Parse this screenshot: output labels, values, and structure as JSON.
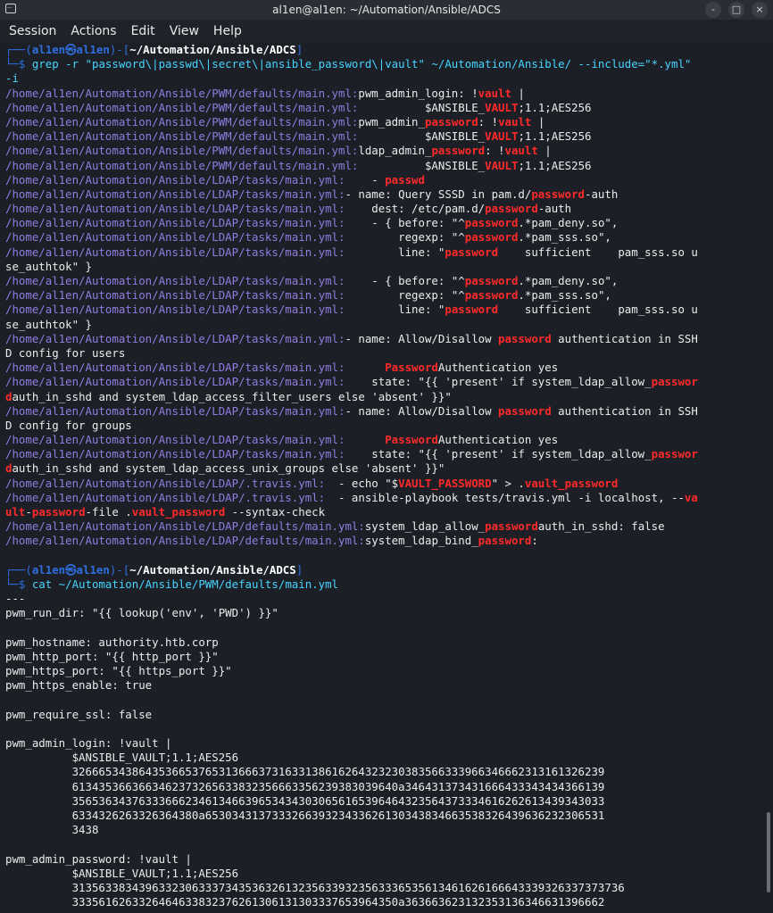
{
  "window": {
    "title": "al1en@al1en: ~/Automation/Ansible/ADCS"
  },
  "menu": [
    "Session",
    "Actions",
    "Edit",
    "View",
    "Help"
  ],
  "controls": {
    "minimize": "-",
    "maximize": "□",
    "close": "×"
  },
  "lines": [
    [
      {
        "c": "p",
        "t": "┌──("
      },
      {
        "c": "u",
        "t": "al1en㉿al1en"
      },
      {
        "c": "p",
        "t": ")-["
      },
      {
        "c": "d",
        "t": "~/Automation/Ansible/ADCS"
      },
      {
        "c": "p",
        "t": "]"
      }
    ],
    [
      {
        "c": "p",
        "t": "└─$ "
      },
      {
        "c": "cmd",
        "t": "grep -r \"password\\|passwd\\|secret\\|ansible_password\\|vault\" ~/Automation/Ansible/ --include=\"*.yml\""
      }
    ],
    [
      {
        "c": "cmd",
        "t": "-i"
      }
    ],
    [
      {
        "c": "path",
        "t": "/home/al1en/Automation/Ansible/PWM/defaults/main.yml:"
      },
      {
        "c": "o",
        "t": "pwm_admin_login: !"
      },
      {
        "c": "h",
        "t": "vault"
      },
      {
        "c": "o",
        "t": " |"
      }
    ],
    [
      {
        "c": "path",
        "t": "/home/al1en/Automation/Ansible/PWM/defaults/main.yml:"
      },
      {
        "c": "o",
        "t": "          $ANSIBLE_"
      },
      {
        "c": "h",
        "t": "VAULT"
      },
      {
        "c": "o",
        "t": ";1.1;AES256"
      }
    ],
    [
      {
        "c": "path",
        "t": "/home/al1en/Automation/Ansible/PWM/defaults/main.yml:"
      },
      {
        "c": "o",
        "t": "pwm_admin_"
      },
      {
        "c": "h",
        "t": "password"
      },
      {
        "c": "o",
        "t": ": !"
      },
      {
        "c": "h",
        "t": "vault"
      },
      {
        "c": "o",
        "t": " |"
      }
    ],
    [
      {
        "c": "path",
        "t": "/home/al1en/Automation/Ansible/PWM/defaults/main.yml:"
      },
      {
        "c": "o",
        "t": "          $ANSIBLE_"
      },
      {
        "c": "h",
        "t": "VAULT"
      },
      {
        "c": "o",
        "t": ";1.1;AES256"
      }
    ],
    [
      {
        "c": "path",
        "t": "/home/al1en/Automation/Ansible/PWM/defaults/main.yml:"
      },
      {
        "c": "o",
        "t": "ldap_admin_"
      },
      {
        "c": "h",
        "t": "password"
      },
      {
        "c": "o",
        "t": ": !"
      },
      {
        "c": "h",
        "t": "vault"
      },
      {
        "c": "o",
        "t": " |"
      }
    ],
    [
      {
        "c": "path",
        "t": "/home/al1en/Automation/Ansible/PWM/defaults/main.yml:"
      },
      {
        "c": "o",
        "t": "          $ANSIBLE_"
      },
      {
        "c": "h",
        "t": "VAULT"
      },
      {
        "c": "o",
        "t": ";1.1;AES256"
      }
    ],
    [
      {
        "c": "path",
        "t": "/home/al1en/Automation/Ansible/LDAP/tasks/main.yml:"
      },
      {
        "c": "o",
        "t": "    - "
      },
      {
        "c": "h",
        "t": "passwd"
      }
    ],
    [
      {
        "c": "path",
        "t": "/home/al1en/Automation/Ansible/LDAP/tasks/main.yml:"
      },
      {
        "c": "o",
        "t": "- name: Query SSSD in pam.d/"
      },
      {
        "c": "h",
        "t": "password"
      },
      {
        "c": "o",
        "t": "-auth"
      }
    ],
    [
      {
        "c": "path",
        "t": "/home/al1en/Automation/Ansible/LDAP/tasks/main.yml:"
      },
      {
        "c": "o",
        "t": "    dest: /etc/pam.d/"
      },
      {
        "c": "h",
        "t": "password"
      },
      {
        "c": "o",
        "t": "-auth"
      }
    ],
    [
      {
        "c": "path",
        "t": "/home/al1en/Automation/Ansible/LDAP/tasks/main.yml:"
      },
      {
        "c": "o",
        "t": "    - { before: \"^"
      },
      {
        "c": "h",
        "t": "password"
      },
      {
        "c": "o",
        "t": ".*pam_deny.so\","
      }
    ],
    [
      {
        "c": "path",
        "t": "/home/al1en/Automation/Ansible/LDAP/tasks/main.yml:"
      },
      {
        "c": "o",
        "t": "        regexp: \"^"
      },
      {
        "c": "h",
        "t": "password"
      },
      {
        "c": "o",
        "t": ".*pam_sss.so\","
      }
    ],
    [
      {
        "c": "path",
        "t": "/home/al1en/Automation/Ansible/LDAP/tasks/main.yml:"
      },
      {
        "c": "o",
        "t": "        line: \""
      },
      {
        "c": "h",
        "t": "password"
      },
      {
        "c": "o",
        "t": "    sufficient    pam_sss.so u"
      }
    ],
    [
      {
        "c": "o",
        "t": "se_authtok\" }"
      }
    ],
    [
      {
        "c": "path",
        "t": "/home/al1en/Automation/Ansible/LDAP/tasks/main.yml:"
      },
      {
        "c": "o",
        "t": "    - { before: \"^"
      },
      {
        "c": "h",
        "t": "password"
      },
      {
        "c": "o",
        "t": ".*pam_deny.so\","
      }
    ],
    [
      {
        "c": "path",
        "t": "/home/al1en/Automation/Ansible/LDAP/tasks/main.yml:"
      },
      {
        "c": "o",
        "t": "        regexp: \"^"
      },
      {
        "c": "h",
        "t": "password"
      },
      {
        "c": "o",
        "t": ".*pam_sss.so\","
      }
    ],
    [
      {
        "c": "path",
        "t": "/home/al1en/Automation/Ansible/LDAP/tasks/main.yml:"
      },
      {
        "c": "o",
        "t": "        line: \""
      },
      {
        "c": "h",
        "t": "password"
      },
      {
        "c": "o",
        "t": "    sufficient    pam_sss.so u"
      }
    ],
    [
      {
        "c": "o",
        "t": "se_authtok\" }"
      }
    ],
    [
      {
        "c": "path",
        "t": "/home/al1en/Automation/Ansible/LDAP/tasks/main.yml:"
      },
      {
        "c": "o",
        "t": "- name: Allow/Disallow "
      },
      {
        "c": "h",
        "t": "password"
      },
      {
        "c": "o",
        "t": " authentication in SSH"
      }
    ],
    [
      {
        "c": "o",
        "t": "D config for users"
      }
    ],
    [
      {
        "c": "path",
        "t": "/home/al1en/Automation/Ansible/LDAP/tasks/main.yml:"
      },
      {
        "c": "o",
        "t": "      "
      },
      {
        "c": "h",
        "t": "Password"
      },
      {
        "c": "o",
        "t": "Authentication yes"
      }
    ],
    [
      {
        "c": "path",
        "t": "/home/al1en/Automation/Ansible/LDAP/tasks/main.yml:"
      },
      {
        "c": "o",
        "t": "    state: \"{{ 'present' if system_ldap_allow_"
      },
      {
        "c": "h",
        "t": "passwor"
      }
    ],
    [
      {
        "c": "h",
        "t": "d"
      },
      {
        "c": "o",
        "t": "auth_in_sshd and system_ldap_access_filter_users else 'absent' }}\""
      }
    ],
    [
      {
        "c": "path",
        "t": "/home/al1en/Automation/Ansible/LDAP/tasks/main.yml:"
      },
      {
        "c": "o",
        "t": "- name: Allow/Disallow "
      },
      {
        "c": "h",
        "t": "password"
      },
      {
        "c": "o",
        "t": " authentication in SSH"
      }
    ],
    [
      {
        "c": "o",
        "t": "D config for groups"
      }
    ],
    [
      {
        "c": "path",
        "t": "/home/al1en/Automation/Ansible/LDAP/tasks/main.yml:"
      },
      {
        "c": "o",
        "t": "      "
      },
      {
        "c": "h",
        "t": "Password"
      },
      {
        "c": "o",
        "t": "Authentication yes"
      }
    ],
    [
      {
        "c": "path",
        "t": "/home/al1en/Automation/Ansible/LDAP/tasks/main.yml:"
      },
      {
        "c": "o",
        "t": "    state: \"{{ 'present' if system_ldap_allow_"
      },
      {
        "c": "h",
        "t": "passwor"
      }
    ],
    [
      {
        "c": "h",
        "t": "d"
      },
      {
        "c": "o",
        "t": "auth_in_sshd and system_ldap_access_unix_groups else 'absent' }}\""
      }
    ],
    [
      {
        "c": "path",
        "t": "/home/al1en/Automation/Ansible/LDAP/.travis.yml:"
      },
      {
        "c": "o",
        "t": "  - echo \"$"
      },
      {
        "c": "h",
        "t": "VAULT_PASSWORD"
      },
      {
        "c": "o",
        "t": "\" > ."
      },
      {
        "c": "h",
        "t": "vault_password"
      }
    ],
    [
      {
        "c": "path",
        "t": "/home/al1en/Automation/Ansible/LDAP/.travis.yml:"
      },
      {
        "c": "o",
        "t": "  - ansible-playbook tests/travis.yml -i localhost, --"
      },
      {
        "c": "h",
        "t": "va"
      }
    ],
    [
      {
        "c": "h",
        "t": "ult"
      },
      {
        "c": "o",
        "t": "-"
      },
      {
        "c": "h",
        "t": "password"
      },
      {
        "c": "o",
        "t": "-file ."
      },
      {
        "c": "h",
        "t": "vault_password"
      },
      {
        "c": "o",
        "t": " --syntax-check"
      }
    ],
    [
      {
        "c": "path",
        "t": "/home/al1en/Automation/Ansible/LDAP/defaults/main.yml:"
      },
      {
        "c": "o",
        "t": "system_ldap_allow_"
      },
      {
        "c": "h",
        "t": "password"
      },
      {
        "c": "o",
        "t": "auth_in_sshd: false"
      }
    ],
    [
      {
        "c": "path",
        "t": "/home/al1en/Automation/Ansible/LDAP/defaults/main.yml:"
      },
      {
        "c": "o",
        "t": "system_ldap_bind_"
      },
      {
        "c": "h",
        "t": "password"
      },
      {
        "c": "o",
        "t": ":"
      }
    ],
    [
      {
        "c": "o",
        "t": ""
      }
    ],
    [
      {
        "c": "p",
        "t": "┌──("
      },
      {
        "c": "u",
        "t": "al1en㉿al1en"
      },
      {
        "c": "p",
        "t": ")-["
      },
      {
        "c": "d",
        "t": "~/Automation/Ansible/ADCS"
      },
      {
        "c": "p",
        "t": "]"
      }
    ],
    [
      {
        "c": "p",
        "t": "└─$ "
      },
      {
        "c": "cmd",
        "t": "cat ~/Automation/Ansible/PWM/defaults/main.yml"
      }
    ],
    [
      {
        "c": "o",
        "t": "---"
      }
    ],
    [
      {
        "c": "o",
        "t": "pwm_run_dir: \"{{ lookup('env', 'PWD') }}\""
      }
    ],
    [
      {
        "c": "o",
        "t": ""
      }
    ],
    [
      {
        "c": "o",
        "t": "pwm_hostname: authority.htb.corp"
      }
    ],
    [
      {
        "c": "o",
        "t": "pwm_http_port: \"{{ http_port }}\""
      }
    ],
    [
      {
        "c": "o",
        "t": "pwm_https_port: \"{{ https_port }}\""
      }
    ],
    [
      {
        "c": "o",
        "t": "pwm_https_enable: true"
      }
    ],
    [
      {
        "c": "o",
        "t": ""
      }
    ],
    [
      {
        "c": "o",
        "t": "pwm_require_ssl: false"
      }
    ],
    [
      {
        "c": "o",
        "t": ""
      }
    ],
    [
      {
        "c": "o",
        "t": "pwm_admin_login: !vault |"
      }
    ],
    [
      {
        "c": "o",
        "t": "          $ANSIBLE_VAULT;1.1;AES256"
      }
    ],
    [
      {
        "c": "o",
        "t": "          32666534386435366537653136663731633138616264323230383566333966346662313161326239"
      }
    ],
    [
      {
        "c": "o",
        "t": "          6134353663663462373265633832356663356239383039640a346431373431666433343434366139"
      }
    ],
    [
      {
        "c": "o",
        "t": "          35653634376333666234613466396534343030656165396464323564373334616262613439343033"
      }
    ],
    [
      {
        "c": "o",
        "t": "          6334326263326364380a653034313733326639323433626130343834663538326439636232306531"
      }
    ],
    [
      {
        "c": "o",
        "t": "          3438"
      }
    ],
    [
      {
        "c": "o",
        "t": ""
      }
    ],
    [
      {
        "c": "o",
        "t": "pwm_admin_password: !vault |"
      }
    ],
    [
      {
        "c": "o",
        "t": "          $ANSIBLE_VAULT;1.1;AES256"
      }
    ],
    [
      {
        "c": "o",
        "t": "          31356338343963323063337343536326132356339323563336535613461626166643339326337373736"
      }
    ],
    [
      {
        "c": "o",
        "t": "          3335616263326464633832376261306131303337653964350a363663623132353136346631396662"
      }
    ]
  ]
}
